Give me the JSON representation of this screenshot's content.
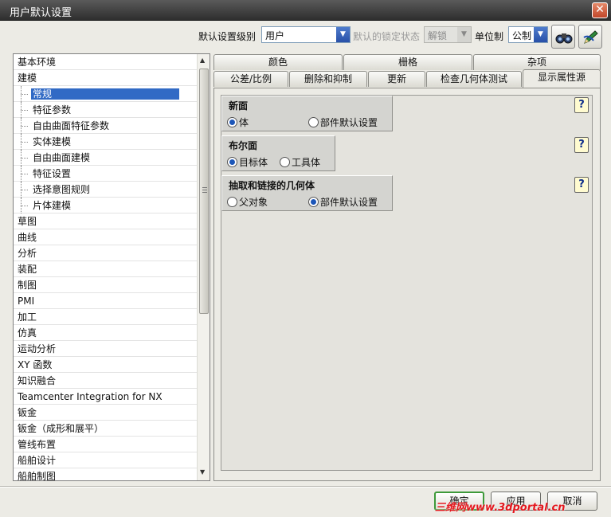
{
  "window": {
    "title": "用户默认设置",
    "close_symbol": "✕"
  },
  "toolbar": {
    "level_label": "默认设置级别",
    "level_value": "用户",
    "lock_state_label": "默认的锁定状态",
    "lock_state_value": "解锁",
    "units_label": "单位制",
    "units_value": "公制",
    "icons": [
      "binoculars-icon",
      "edit-pencil-icon"
    ]
  },
  "tree": {
    "items": [
      {
        "label": "基本环境",
        "level": 0,
        "selected": false
      },
      {
        "label": "建模",
        "level": 0,
        "selected": false
      },
      {
        "label": "常规",
        "level": 1,
        "selected": true
      },
      {
        "label": "特征参数",
        "level": 1,
        "selected": false
      },
      {
        "label": "自由曲面特征参数",
        "level": 1,
        "selected": false
      },
      {
        "label": "实体建模",
        "level": 1,
        "selected": false
      },
      {
        "label": "自由曲面建模",
        "level": 1,
        "selected": false
      },
      {
        "label": "特征设置",
        "level": 1,
        "selected": false
      },
      {
        "label": "选择意图规则",
        "level": 1,
        "selected": false
      },
      {
        "label": "片体建模",
        "level": 1,
        "selected": false
      },
      {
        "label": "草图",
        "level": 0,
        "selected": false
      },
      {
        "label": "曲线",
        "level": 0,
        "selected": false
      },
      {
        "label": "分析",
        "level": 0,
        "selected": false
      },
      {
        "label": "装配",
        "level": 0,
        "selected": false
      },
      {
        "label": "制图",
        "level": 0,
        "selected": false
      },
      {
        "label": "PMI",
        "level": 0,
        "selected": false
      },
      {
        "label": "加工",
        "level": 0,
        "selected": false
      },
      {
        "label": "仿真",
        "level": 0,
        "selected": false
      },
      {
        "label": "运动分析",
        "level": 0,
        "selected": false
      },
      {
        "label": "XY 函数",
        "level": 0,
        "selected": false
      },
      {
        "label": "知识融合",
        "level": 0,
        "selected": false
      },
      {
        "label": "Teamcenter Integration for NX",
        "level": 0,
        "selected": false
      },
      {
        "label": "钣金",
        "level": 0,
        "selected": false
      },
      {
        "label": "钣金（成形和展平）",
        "level": 0,
        "selected": false
      },
      {
        "label": "管线布置",
        "level": 0,
        "selected": false
      },
      {
        "label": "船舶设计",
        "level": 0,
        "selected": false
      },
      {
        "label": "船舶制图",
        "level": 0,
        "selected": false
      }
    ]
  },
  "tabs": {
    "row1": [
      "颜色",
      "栅格",
      "杂项"
    ],
    "row2": [
      "公差/比例",
      "删除和抑制",
      "更新",
      "检查几何体测试",
      "显示属性源"
    ],
    "active": "显示属性源"
  },
  "groups": [
    {
      "title": "新面",
      "options": [
        {
          "label": "体",
          "selected": true
        },
        {
          "label": "部件默认设置",
          "selected": false
        }
      ]
    },
    {
      "title": "布尔面",
      "options": [
        {
          "label": "目标体",
          "selected": true
        },
        {
          "label": "工具体",
          "selected": false
        }
      ]
    },
    {
      "title": "抽取和链接的几何体",
      "options": [
        {
          "label": "父对象",
          "selected": false
        },
        {
          "label": "部件默认设置",
          "selected": true
        }
      ]
    }
  ],
  "help_symbol": "?",
  "buttons": {
    "ok": "确定",
    "apply": "应用",
    "cancel": "取消"
  },
  "watermark": "三维网www.3dportal.cn"
}
